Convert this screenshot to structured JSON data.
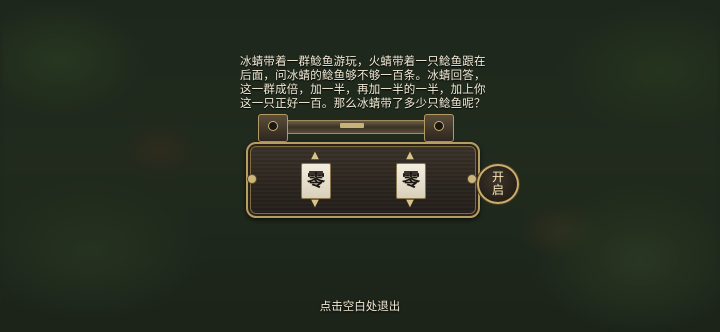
{
  "puzzle": {
    "riddle": "冰蜻带着一群鲶鱼游玩，火蜻带着一只鲶鱼跟在\n后面，问冰蜻的鲶鱼够不够一百条。冰蜻回答，\n这一群成倍，加一半，再加一半的一半，加上你\n这一只正好一百。那么冰蜻带了多少只鲶鱼呢？"
  },
  "lock": {
    "dials": [
      {
        "value": "零"
      },
      {
        "value": "零"
      }
    ],
    "open_label": "开启"
  },
  "footer": {
    "exit_hint": "点击空白处退出"
  }
}
